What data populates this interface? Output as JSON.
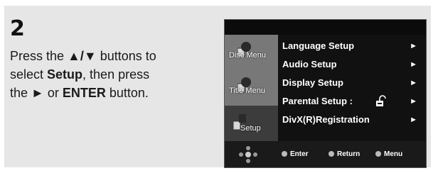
{
  "step": {
    "number": "2",
    "instruction_lines": [
      {
        "parts": [
          "Press the ",
          "▲/▼",
          " buttons to"
        ]
      },
      {
        "parts": [
          "select ",
          "Setup",
          ", then press"
        ]
      },
      {
        "parts": [
          "the ",
          "►",
          " or ",
          "ENTER",
          " button."
        ]
      }
    ]
  },
  "screen": {
    "sidebar": [
      {
        "label": "Disc Menu",
        "icon": "disc-menu-icon"
      },
      {
        "label": "Title Menu",
        "icon": "title-menu-icon"
      },
      {
        "label": "Setup",
        "icon": "setup-icon",
        "active": true
      }
    ],
    "menu": [
      {
        "label": "Language Setup",
        "arrow": "►"
      },
      {
        "label": "Audio Setup",
        "arrow": "►"
      },
      {
        "label": "Display Setup",
        "arrow": "►"
      },
      {
        "label": "Parental Setup :",
        "arrow": "►",
        "icon": "lock-icon"
      },
      {
        "label": "DivX(R)Registration",
        "arrow": "►"
      }
    ],
    "bottom_bar": {
      "enter": "Enter",
      "return": "Return",
      "menu": "Menu"
    }
  },
  "colors": {
    "panel_bg": "#e6e6e6",
    "screen_bg": "#0b0b0b",
    "sidebar_bg": "#787878"
  }
}
